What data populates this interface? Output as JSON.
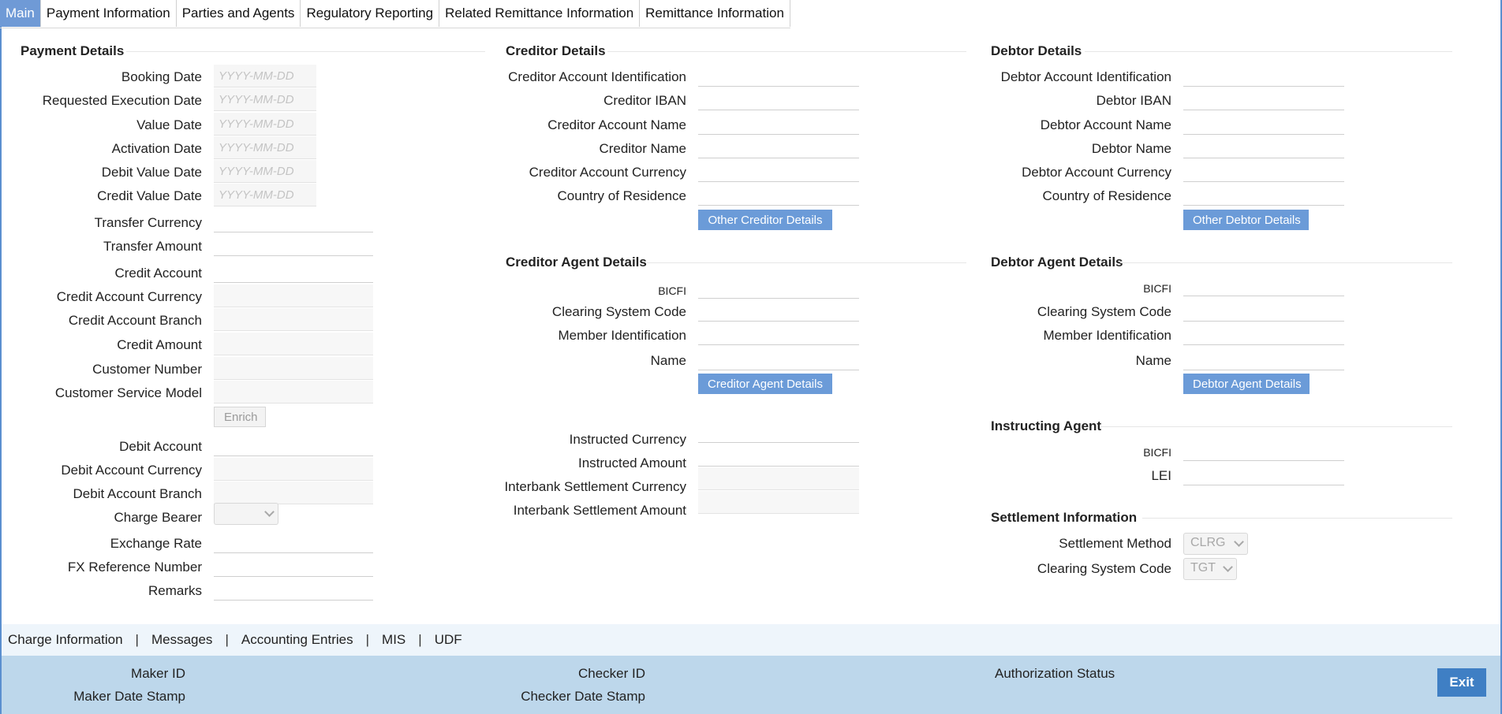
{
  "tabs": [
    "Main",
    "Payment Information",
    "Parties and Agents",
    "Regulatory Reporting",
    "Related Remittance Information",
    "Remittance Information"
  ],
  "payment_details": {
    "title": "Payment Details",
    "date_placeholder": "YYYY-MM-DD",
    "booking_date": "Booking Date",
    "requested_execution_date": "Requested Execution Date",
    "value_date": "Value Date",
    "activation_date": "Activation Date",
    "debit_value_date": "Debit Value Date",
    "credit_value_date": "Credit Value Date",
    "transfer_currency": "Transfer Currency",
    "transfer_amount": "Transfer Amount",
    "credit_account": "Credit Account",
    "credit_account_currency": "Credit Account Currency",
    "credit_account_branch": "Credit Account Branch",
    "credit_amount": "Credit Amount",
    "customer_number": "Customer Number",
    "customer_service_model": "Customer Service Model",
    "enrich_button": "Enrich",
    "debit_account": "Debit Account",
    "debit_account_currency": "Debit Account Currency",
    "debit_account_branch": "Debit Account Branch",
    "charge_bearer": "Charge Bearer",
    "exchange_rate": "Exchange Rate",
    "fx_reference_number": "FX Reference Number",
    "remarks": "Remarks"
  },
  "creditor_details": {
    "title": "Creditor Details",
    "account_identification": "Creditor Account Identification",
    "iban": "Creditor IBAN",
    "account_name": "Creditor Account Name",
    "name": "Creditor Name",
    "account_currency": "Creditor Account Currency",
    "country_of_residence": "Country of Residence",
    "other_button": "Other Creditor Details"
  },
  "creditor_agent": {
    "title": "Creditor Agent Details",
    "bicfi": "BICFI",
    "clearing_system_code": "Clearing System Code",
    "member_identification": "Member Identification",
    "name": "Name",
    "button": "Creditor Agent Details"
  },
  "instructed": {
    "instructed_currency": "Instructed Currency",
    "instructed_amount": "Instructed Amount",
    "interbank_settlement_currency": "Interbank Settlement Currency",
    "interbank_settlement_amount": "Interbank Settlement Amount"
  },
  "debtor_details": {
    "title": "Debtor Details",
    "account_identification": "Debtor Account Identification",
    "iban": "Debtor IBAN",
    "account_name": "Debtor Account Name",
    "name": "Debtor Name",
    "account_currency": "Debtor Account Currency",
    "country_of_residence": "Country of Residence",
    "other_button": "Other Debtor Details"
  },
  "debtor_agent": {
    "title": "Debtor Agent Details",
    "bicfi": "BICFI",
    "clearing_system_code": "Clearing System Code",
    "member_identification": "Member Identification",
    "name": "Name",
    "button": "Debtor Agent Details"
  },
  "instructing_agent": {
    "title": "Instructing Agent",
    "bicfi": "BICFI",
    "lei": "LEI"
  },
  "settlement": {
    "title": "Settlement Information",
    "method_label": "Settlement Method",
    "method_value": "CLRG",
    "clearing_label": "Clearing System Code",
    "clearing_value": "TGT"
  },
  "footer_links": [
    "Charge Information",
    "Messages",
    "Accounting Entries",
    "MIS",
    "UDF"
  ],
  "footer_separator": "|",
  "audit": {
    "maker_id": "Maker ID",
    "maker_date_stamp": "Maker Date Stamp",
    "checker_id": "Checker ID",
    "checker_date_stamp": "Checker Date Stamp",
    "authorization_status": "Authorization Status",
    "exit_button": "Exit"
  }
}
